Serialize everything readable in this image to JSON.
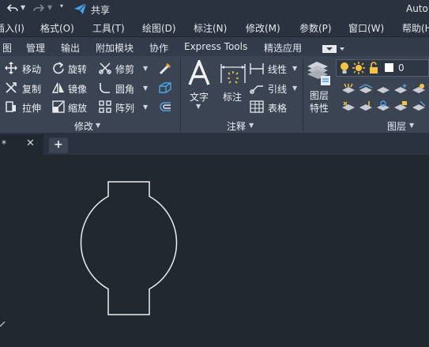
{
  "title_bar": {
    "share_label": "共享",
    "app_title": "Auto"
  },
  "menu": [
    "插入(I)",
    "格式(O)",
    "工具(T)",
    "绘图(D)",
    "标注(N)",
    "修改(M)",
    "参数(P)",
    "窗口(W)",
    "帮助(H)"
  ],
  "ribbon_tabs": [
    "图",
    "管理",
    "输出",
    "附加模块",
    "协作",
    "Express Tools",
    "精选应用"
  ],
  "modify_panel": {
    "move": "移动",
    "rotate": "旋转",
    "trim": "修剪",
    "copy": "复制",
    "mirror": "镜像",
    "fillet": "圆角",
    "stretch": "拉伸",
    "scale": "缩放",
    "array": "阵列",
    "title": "修改"
  },
  "annotation_panel": {
    "text": "文字",
    "dimension": "标注",
    "linear": "线性",
    "leader": "引线",
    "table": "表格",
    "title": "注释"
  },
  "layer_panel": {
    "layer_props_line1": "图层",
    "layer_props_line2": "特性",
    "current_layer": "0",
    "title": "图层"
  },
  "doc_tabs": {
    "current": "*"
  },
  "colors": {
    "accent_blue": "#4aa3e8",
    "bulb_yellow": "#f5c542",
    "ribbon_bg": "#3b4453",
    "canvas_bg": "#212830"
  }
}
